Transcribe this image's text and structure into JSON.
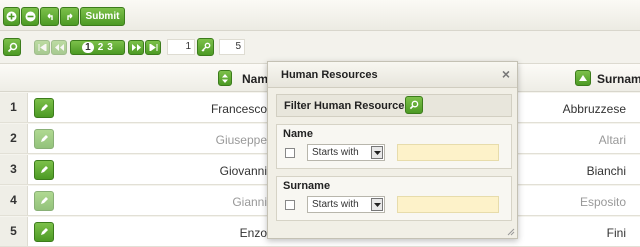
{
  "toolbar": {
    "add_icon": "plus-circle-icon",
    "remove_icon": "minus-circle-icon",
    "undo_icon": "undo-icon",
    "redo_icon": "redo-icon",
    "submit_label": "Submit"
  },
  "pager": {
    "search_icon": "search-icon",
    "pages": [
      "1",
      "2",
      "3"
    ],
    "current_page": "1",
    "page_input": "1",
    "page_size": "5"
  },
  "grid": {
    "columns": {
      "name": "Name",
      "surname": "Surname"
    },
    "rows": [
      {
        "num": "1",
        "name": "Francesco",
        "surname": "Abbruzzese",
        "enabled": true
      },
      {
        "num": "2",
        "name": "Giuseppe",
        "surname": "Altari",
        "enabled": false
      },
      {
        "num": "3",
        "name": "Giovanni",
        "surname": "Bianchi",
        "enabled": true
      },
      {
        "num": "4",
        "name": "Gianni",
        "surname": "Esposito",
        "enabled": false
      },
      {
        "num": "5",
        "name": "Enzo",
        "surname": "Fini",
        "enabled": true
      }
    ]
  },
  "dialog": {
    "title": "Human Resources",
    "filter_label": "Filter Human Resources",
    "sections": [
      {
        "label": "Name",
        "operator": "Starts with",
        "value": ""
      },
      {
        "label": "Surname",
        "operator": "Starts with",
        "value": ""
      }
    ]
  },
  "colors": {
    "accent_green": "#5aa82e",
    "input_highlight": "#fdf2c9"
  }
}
